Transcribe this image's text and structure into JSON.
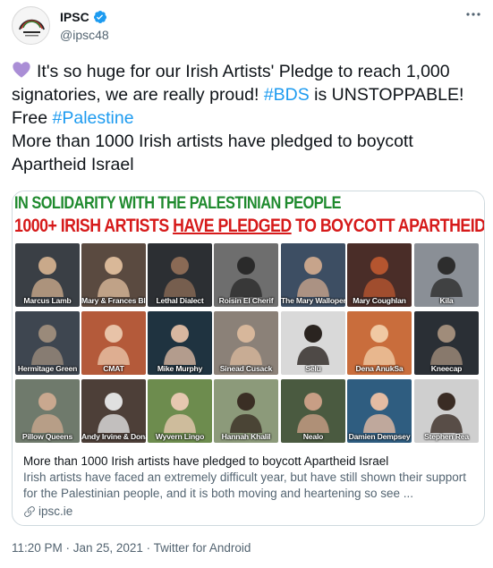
{
  "author": {
    "name": "IPSC",
    "handle": "@ipsc48",
    "verified": true
  },
  "tweet": {
    "heart_emoji": "purple-heart",
    "segments": {
      "t1": "It's so huge for our Irish Artists' Pledge to reach 1,000 signatories, we are really proud!  ",
      "link1": "#BDS",
      "t2": " is UNSTOPPABLE! Free ",
      "link2": "#Palestine",
      "t3": "More than 1000 Irish artists have pledged to boycott Apartheid Israel"
    }
  },
  "card": {
    "banner_line1": "IN SOLIDARITY WITH THE PALESTINIAN PEOPLE",
    "banner_line2_pre": "1000+ IRISH ARTISTS ",
    "banner_line2_u": "HAVE PLEDGED",
    "banner_line2_post": " TO BOYCOTT APARTHEID ISRAEL!",
    "artists": [
      {
        "label": "Marcus Lamb",
        "bg": "#3a3f45",
        "fg": "#c9a98a"
      },
      {
        "label": "Mary & Frances Black",
        "bg": "#5a4a40",
        "fg": "#d9b898"
      },
      {
        "label": "Lethal Dialect",
        "bg": "#2c2f33",
        "fg": "#8a6a55"
      },
      {
        "label": "Roisin El Cherif",
        "bg": "#6e6e6e",
        "fg": "#2a2a2a"
      },
      {
        "label": "The Mary Wallopers",
        "bg": "#3d4e63",
        "fg": "#c7a48b"
      },
      {
        "label": "Mary Coughlan",
        "bg": "#4a2d28",
        "fg": "#b5552f"
      },
      {
        "label": "Kila",
        "bg": "#8a8f96",
        "fg": "#2d2d2d"
      },
      {
        "label": "Hermitage Green",
        "bg": "#3e4650",
        "fg": "#9a8a7a"
      },
      {
        "label": "CMAT",
        "bg": "#b45a3a",
        "fg": "#e8c3a8"
      },
      {
        "label": "Mike Murphy",
        "bg": "#1f3340",
        "fg": "#d8b7a0"
      },
      {
        "label": "Sinead Cusack",
        "bg": "#8b8178",
        "fg": "#d7b79b"
      },
      {
        "label": "Selu",
        "bg": "#d9d9d9",
        "fg": "#2a2420"
      },
      {
        "label": "Dena AnukSa",
        "bg": "#c96d3c",
        "fg": "#f0c9a3"
      },
      {
        "label": "Kneecap",
        "bg": "#2a2f35",
        "fg": "#a08c7a"
      },
      {
        "label": "Pillow Queens",
        "bg": "#6f7a6c",
        "fg": "#c9a88f"
      },
      {
        "label": "Andy Irvine & Donal Lunny",
        "bg": "#4d3f38",
        "fg": "#e0e0e0"
      },
      {
        "label": "Wyvern Lingo",
        "bg": "#6d8c4e",
        "fg": "#e6c8b0"
      },
      {
        "label": "Hannah Khalil",
        "bg": "#8c9a7a",
        "fg": "#3a2e24"
      },
      {
        "label": "Nealo",
        "bg": "#4a5a40",
        "fg": "#c89e85"
      },
      {
        "label": "Damien Dempsey",
        "bg": "#2f5d80",
        "fg": "#e4bca3"
      },
      {
        "label": "Stephen Rea",
        "bg": "#cfcfcf",
        "fg": "#3a2c24"
      }
    ],
    "title": "More than 1000 Irish artists have pledged to boycott Apartheid Israel",
    "description": "Irish artists have faced an extremely difficult year, but have still shown their support for the Palestinian people, and it is both moving and heartening so see ...",
    "domain": "ipsc.ie"
  },
  "meta": {
    "time": "11:20 PM",
    "date": "Jan 25, 2021",
    "source": "Twitter for Android",
    "separator": " · "
  },
  "colors": {
    "link": "#1d9bf0",
    "secondary": "#536471",
    "verified": "#1d9bf0",
    "banner_green": "#1f8a2e",
    "banner_red": "#d61a1a"
  }
}
